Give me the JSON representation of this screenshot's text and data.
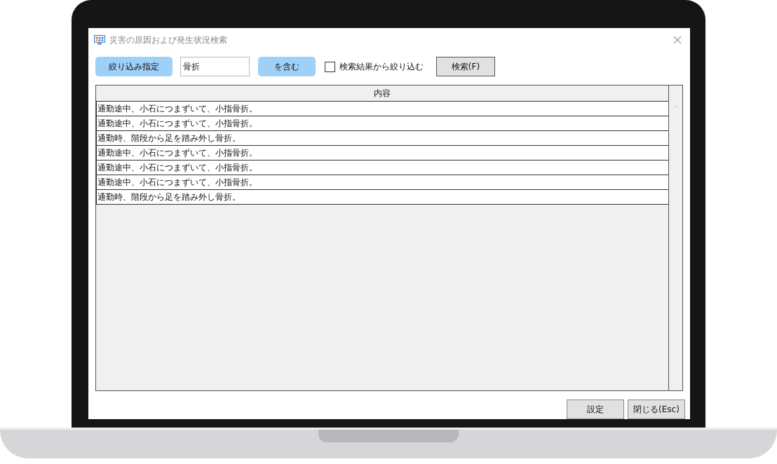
{
  "window": {
    "title": "災害の原因および発生状況検索"
  },
  "toolbar": {
    "filter_button": "絞り込み指定",
    "search_field": {
      "value": "骨折"
    },
    "contains_button": "を含む",
    "refine_checkbox": {
      "label": "検索結果から絞り込む",
      "checked": false
    },
    "search_button": "検索(F)"
  },
  "table": {
    "columns": [
      "内容"
    ],
    "rows": [
      {
        "cells": [
          "通勤途中、小石につまずいて、小指骨折。"
        ]
      },
      {
        "cells": [
          "通勤途中、小石につまずいて、小指骨折。"
        ]
      },
      {
        "cells": [
          "通勤時、階段から足を踏み外し骨折。"
        ]
      },
      {
        "cells": [
          "通勤途中、小石につまずいて、小指骨折。"
        ]
      },
      {
        "cells": [
          "通勤途中、小石につまずいて、小指骨折。"
        ]
      },
      {
        "cells": [
          "通勤途中、小石につまずいて、小指骨折。"
        ]
      },
      {
        "cells": [
          "通勤時、階段から足を踏み外し骨折。"
        ]
      }
    ]
  },
  "footer_buttons": [
    "設定",
    "閉じる(Esc)"
  ]
}
